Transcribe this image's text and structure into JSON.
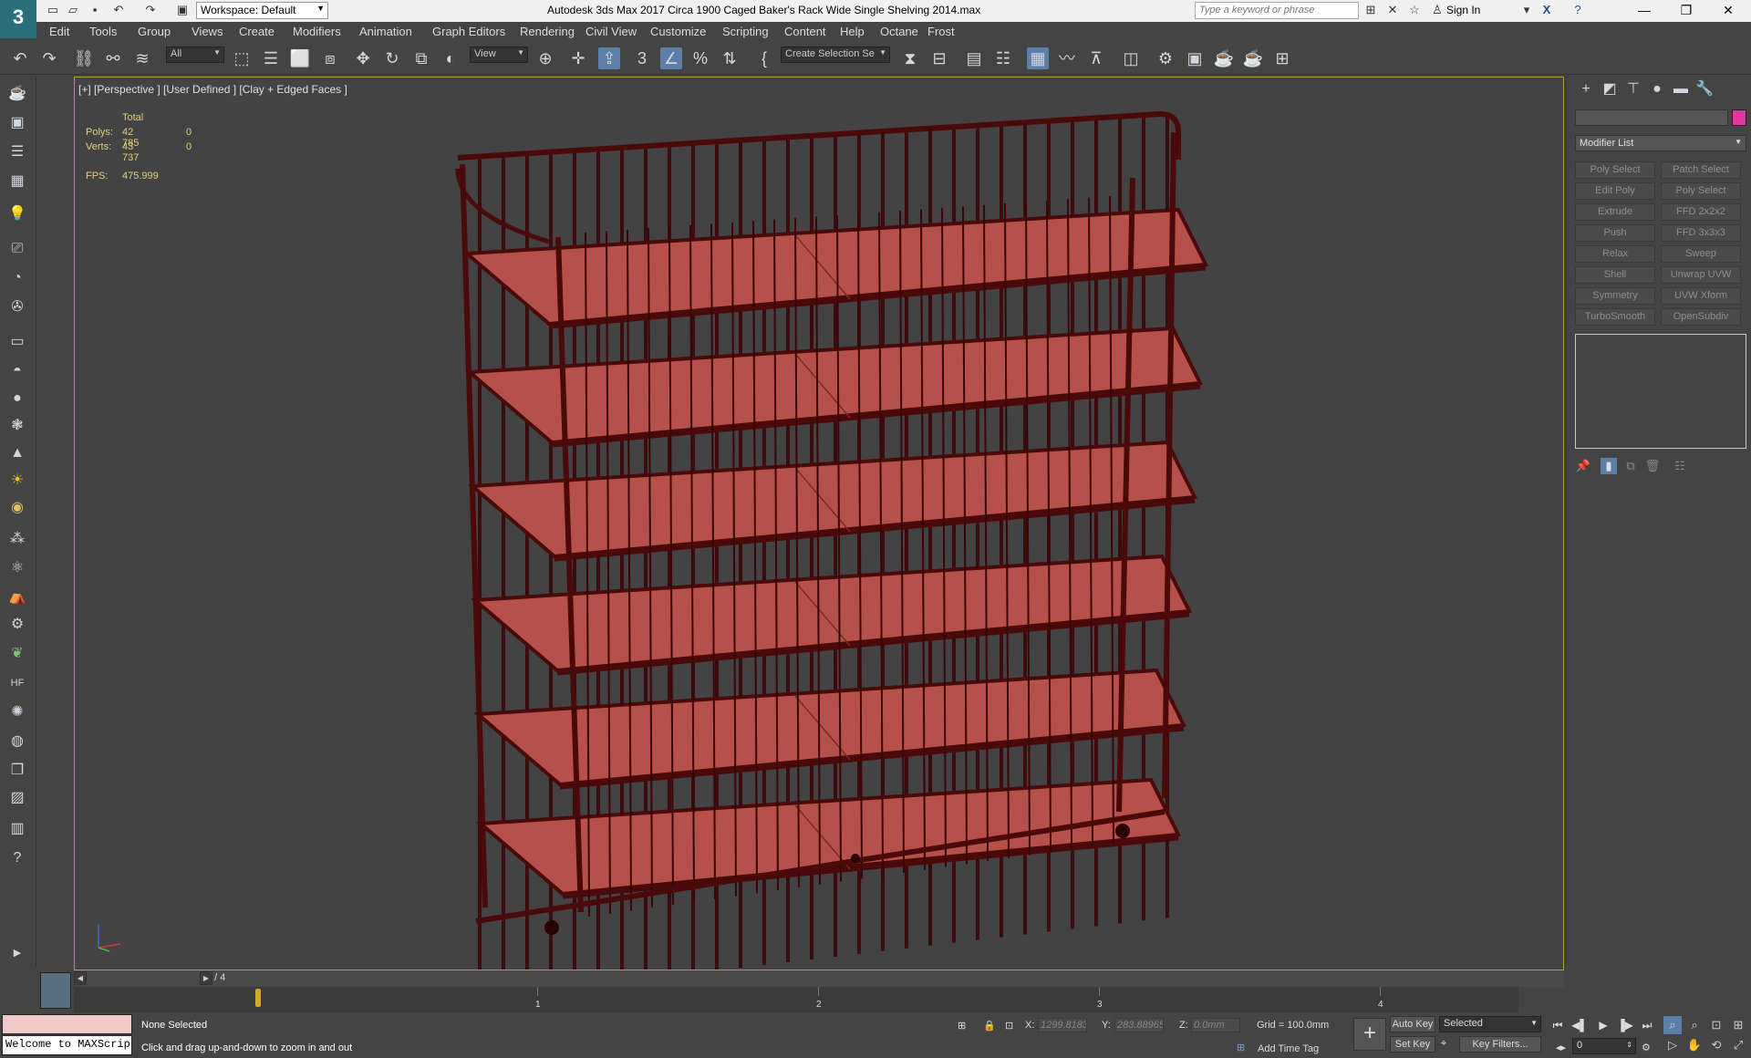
{
  "titlebar": {
    "app_logo": "3",
    "workspace": "Workspace: Default",
    "title": "Autodesk 3ds Max 2017    Circa 1900 Caged Baker's Rack Wide Single Shelving 2014.max",
    "search_placeholder": "Type a keyword or phrase",
    "sign_in": "Sign In"
  },
  "menu": [
    "Edit",
    "Tools",
    "Group",
    "Views",
    "Create",
    "Modifiers",
    "Animation",
    "Graph Editors",
    "Rendering",
    "Civil View",
    "Customize",
    "Scripting",
    "Content",
    "Help",
    "Octane",
    "Frost"
  ],
  "toolbar": {
    "filter": "All",
    "reference_coord": "View",
    "named_selection": "Create Selection Se"
  },
  "viewport": {
    "label": "[+] [Perspective ] [User Defined ] [Clay + Edged Faces ]",
    "stats": {
      "header": "Total",
      "polys_label": "Polys:",
      "polys": "42 785",
      "polys_sel": "0",
      "verts_label": "Verts:",
      "verts": "43 737",
      "verts_sel": "0",
      "fps_label": "FPS:",
      "fps": "475.999"
    },
    "colors": {
      "shelf": "#b5514a",
      "frame": "#4a0a0a",
      "background": "#434343"
    }
  },
  "command_panel": {
    "modifier_list": "Modifier List",
    "swatch_color": "#e0389e",
    "modifiers": [
      "Poly Select",
      "Patch Select",
      "Edit Poly",
      "Poly Select",
      "Extrude",
      "FFD 2x2x2",
      "Push",
      "FFD 3x3x3",
      "Relax",
      "Sweep",
      "Shell",
      "Unwrap UVW",
      "Symmetry",
      "UVW Xform",
      "TurboSmooth",
      "OpenSubdiv"
    ]
  },
  "timeline": {
    "frame": "0 / 4",
    "ticks": [
      "1",
      "2",
      "3",
      "4"
    ]
  },
  "status": {
    "listener": "Welcome to MAXScrip",
    "selection": "None Selected",
    "prompt": "Click and drag up-and-down to zoom in and out",
    "x_label": "X:",
    "x": "1299.8183",
    "y_label": "Y:",
    "y": "283.88965",
    "z_label": "Z:",
    "z": "0.0mm",
    "grid": "Grid = 100.0mm",
    "add_time_tag": "Add Time Tag",
    "auto_key": "Auto Key",
    "set_key": "Set Key",
    "key_mode": "Selected",
    "key_filters": "Key Filters...",
    "current_frame": "0"
  }
}
